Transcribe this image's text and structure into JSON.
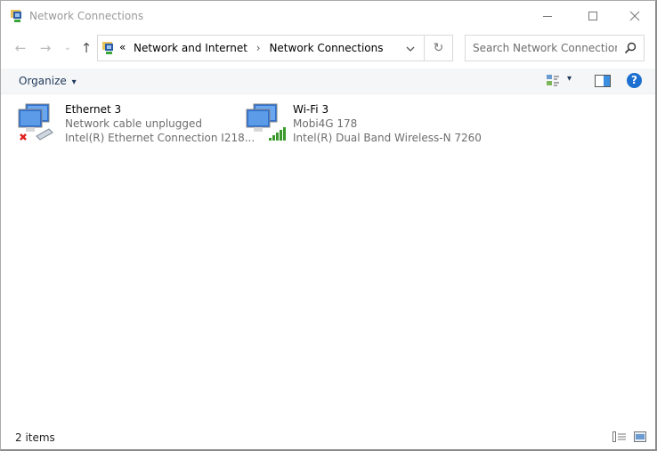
{
  "window": {
    "title": "Network Connections",
    "controls": {
      "minimize": "minimize-icon",
      "maximize": "maximize-icon",
      "close": "close-icon"
    }
  },
  "nav": {
    "back": "←",
    "forward": "→",
    "recent": "⌄",
    "up": "↑",
    "overflow": "«",
    "breadcrumb": [
      "Network and Internet",
      "Network Connections"
    ],
    "separator": "›",
    "refresh": "↻",
    "search_placeholder": "Search Network Connections"
  },
  "toolbar": {
    "organize_label": "Organize",
    "organize_caret": "▾",
    "view_caret": "▾",
    "help": "?"
  },
  "connections": [
    {
      "name": "Ethernet 3",
      "status": "Network cable unplugged",
      "device": "Intel(R) Ethernet Connection I218...",
      "type": "ethernet",
      "connected": false
    },
    {
      "name": "Wi-Fi 3",
      "status": "Mobi4G 178",
      "device": "Intel(R) Dual Band Wireless-N 7260",
      "type": "wifi",
      "connected": true
    }
  ],
  "statusbar": {
    "item_count": "2 items"
  },
  "colors": {
    "accent": "#0066cc",
    "help": "#1a6fd1",
    "error": "#e0201d",
    "signal": "#3a9a2c"
  }
}
